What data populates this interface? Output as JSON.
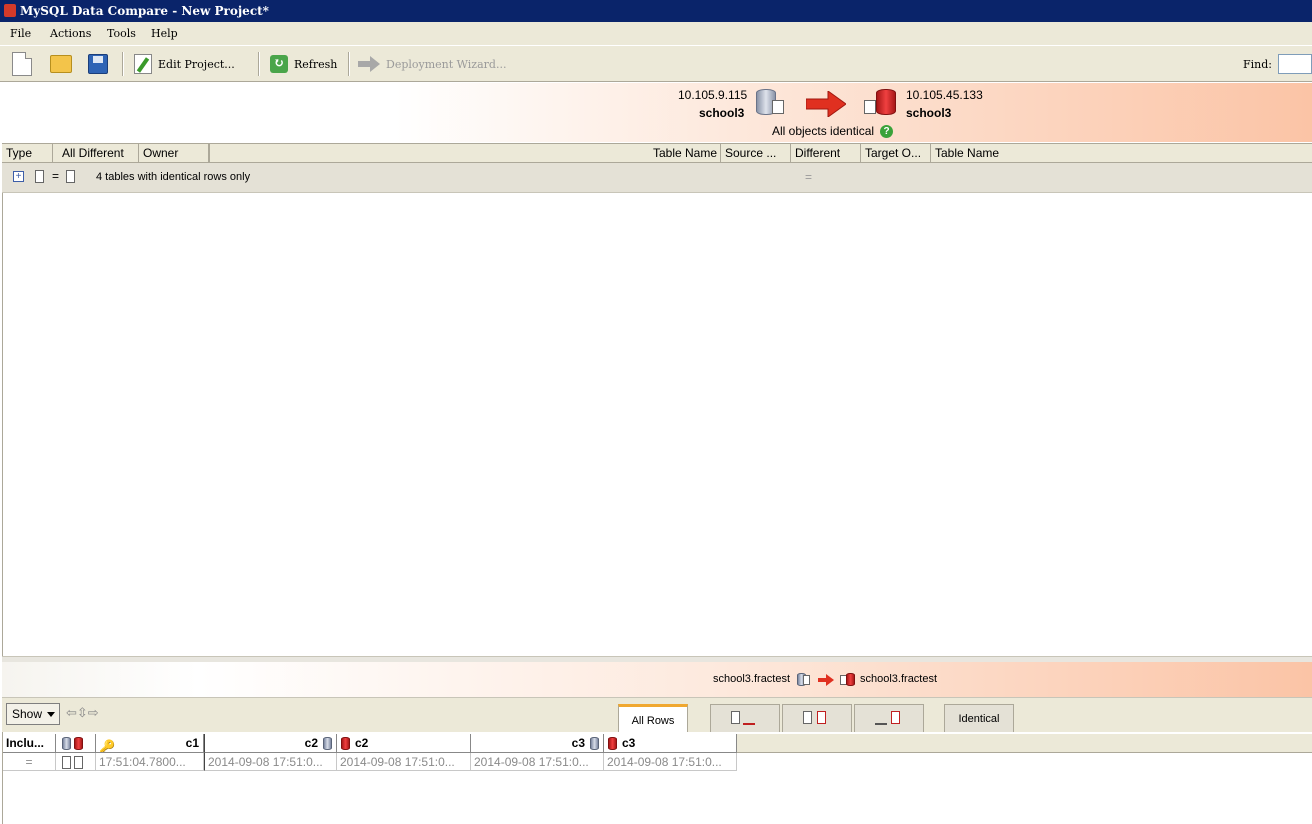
{
  "window": {
    "title": "MySQL Data Compare - New Project*"
  },
  "menu": [
    "File",
    "Actions",
    "Tools",
    "Help"
  ],
  "toolbar": {
    "edit_project": "Edit Project...",
    "refresh": "Refresh",
    "deployment_wizard": "Deployment Wizard...",
    "find_label": "Find:",
    "find_value": ""
  },
  "connection": {
    "source_host": "10.105.9.115",
    "source_db": "school3",
    "target_host": "10.105.45.133",
    "target_db": "school3",
    "status": "All objects identical"
  },
  "grid": {
    "columns": [
      "Type",
      "All Different",
      "Owner",
      "Table Name",
      "Source ...",
      "Different",
      "Target O...",
      "Table Name"
    ],
    "group_label": "4 tables with identical rows only",
    "group_symbol": "=",
    "group_diff_symbol": "="
  },
  "table_compare": {
    "source_table": "school3.fractest",
    "target_table": "school3.fractest"
  },
  "lower_toolbar": {
    "show_label": "Show",
    "tabs": [
      "All Rows",
      "",
      "",
      "",
      "Identical"
    ],
    "active_tab": "All Rows"
  },
  "rows": {
    "headers": [
      "Inclu...",
      "c1",
      "c2",
      "c2",
      "c3",
      "c3"
    ],
    "row": {
      "include": "=",
      "c1": "17:51:04.7800...",
      "c2_source": "2014-09-08 17:51:0...",
      "c2_target": "2014-09-08 17:51:0...",
      "c3_source": "2014-09-08 17:51:0...",
      "c3_target": "2014-09-08 17:51:0..."
    }
  },
  "colors": {
    "titlebar": "#0a246a",
    "accent_red": "#e03020",
    "help_green": "#3aa23a"
  }
}
